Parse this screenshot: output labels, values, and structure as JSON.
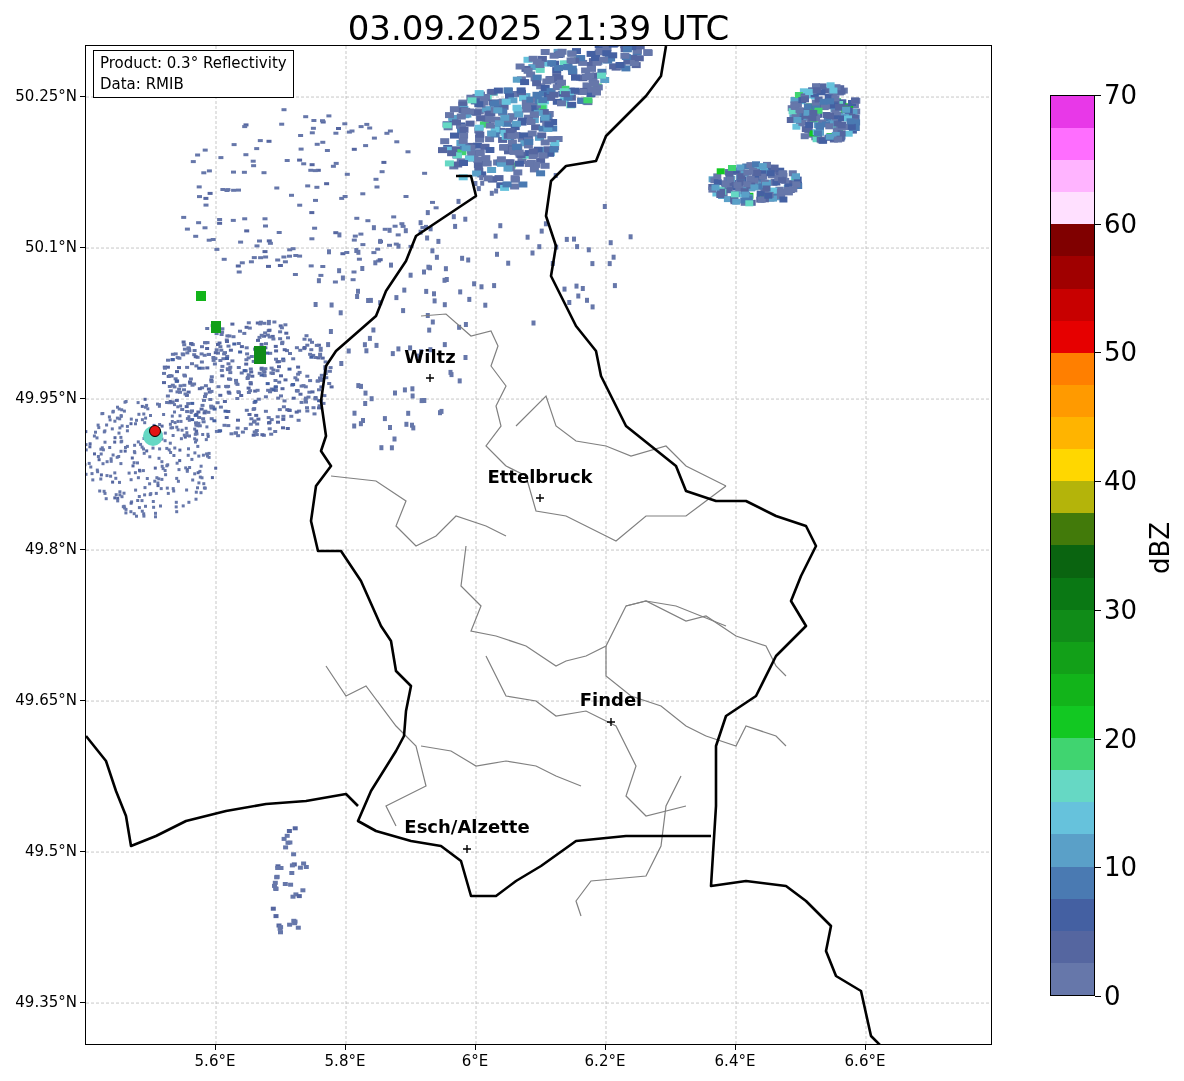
{
  "title": "03.09.2025 21:39 UTC",
  "info_box": [
    "Product: 0.3° Reflectivity",
    "Data: RMIB"
  ],
  "map": {
    "x_ticks": [
      "5.6°E",
      "5.8°E",
      "6°E",
      "6.2°E",
      "6.4°E",
      "6.6°E"
    ],
    "y_ticks": [
      "50.25°N",
      "50.1°N",
      "49.95°N",
      "49.8°N",
      "49.65°N",
      "49.5°N",
      "49.35°N"
    ],
    "cities": [
      {
        "label": "Wiltz"
      },
      {
        "label": "Ettelbruck"
      },
      {
        "label": "Findel"
      },
      {
        "label": "Esch/Alzette"
      }
    ]
  },
  "colorbar": {
    "label": "dBZ",
    "ticks": [
      "70",
      "60",
      "50",
      "40",
      "30",
      "20",
      "10",
      "0"
    ],
    "bands": [
      {
        "color": "#6677aa"
      },
      {
        "color": "#5566a0"
      },
      {
        "color": "#4460a2"
      },
      {
        "color": "#4a7ab2"
      },
      {
        "color": "#5aa0c8"
      },
      {
        "color": "#66c2dc"
      },
      {
        "color": "#66d8c4"
      },
      {
        "color": "#40d470"
      },
      {
        "color": "#12c822"
      },
      {
        "color": "#12b41a"
      },
      {
        "color": "#12a018"
      },
      {
        "color": "#108c18"
      },
      {
        "color": "#0a7814"
      },
      {
        "color": "#0a6410"
      },
      {
        "color": "#427a0a"
      },
      {
        "color": "#b4b40a"
      },
      {
        "color": "#ffd700"
      },
      {
        "color": "#ffb400"
      },
      {
        "color": "#ff9a00"
      },
      {
        "color": "#ff7f00"
      },
      {
        "color": "#e60000"
      },
      {
        "color": "#c80000"
      },
      {
        "color": "#a00000"
      },
      {
        "color": "#800000"
      },
      {
        "color": "#ffe0ff"
      },
      {
        "color": "#ffb4ff"
      },
      {
        "color": "#ff6eff"
      },
      {
        "color": "#e838e8"
      }
    ]
  }
}
